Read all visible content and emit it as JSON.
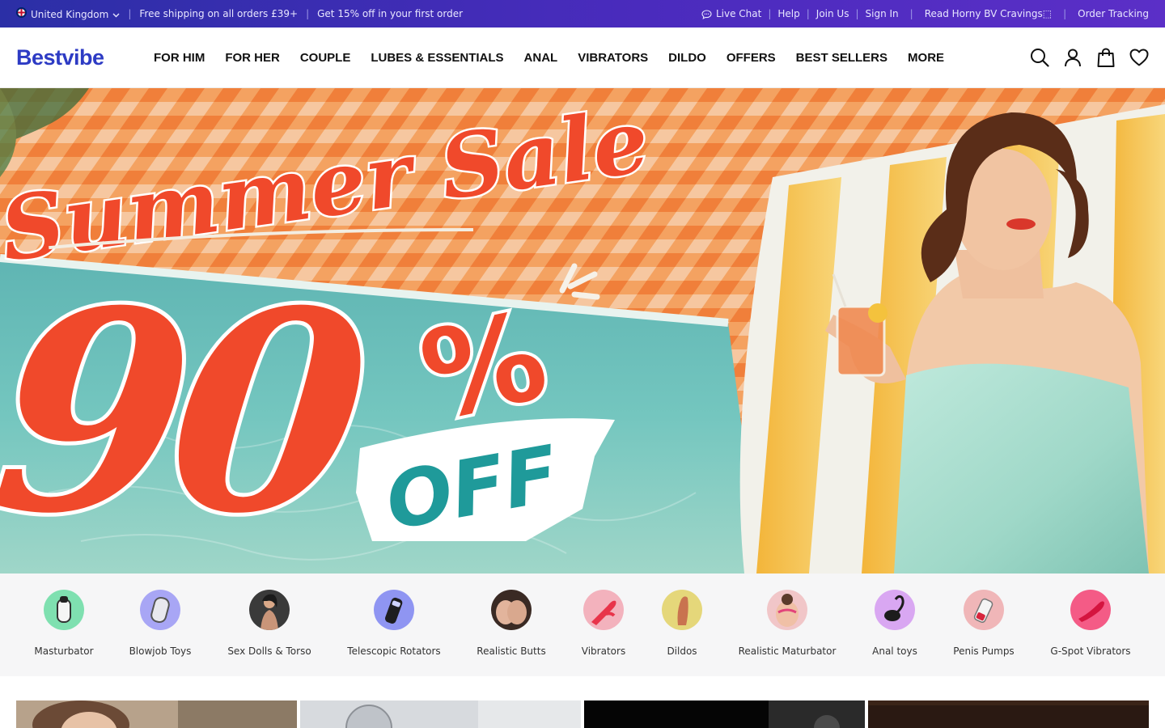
{
  "topbar": {
    "region": "United Kingdom",
    "shipping": "Free shipping on all orders £39+",
    "discount": "Get 15% off in your first order",
    "links": [
      "Live Chat",
      "Help",
      "Join Us",
      "Sign In",
      "Read Horny BV Cravings⬚",
      "Order Tracking"
    ]
  },
  "header": {
    "logo": "Bestvibe",
    "nav": [
      "FOR HIM",
      "FOR HER",
      "COUPLE",
      "LUBES & ESSENTIALS",
      "ANAL",
      "VIBRATORS",
      "DILDO",
      "OFFERS",
      "BEST SELLERS",
      "MORE"
    ],
    "icons": [
      "search-icon",
      "account-icon",
      "bag-icon",
      "heart-icon"
    ]
  },
  "hero": {
    "headline": "Summer Sale",
    "amount": "90",
    "percent": "%",
    "off": "OFF"
  },
  "categories": [
    {
      "label": "Masturbator",
      "color": "#7fe0b0",
      "icon": "masturbator-thumb"
    },
    {
      "label": "Blowjob Toys",
      "color": "#a8a6f5",
      "icon": "blowjob-toy-thumb"
    },
    {
      "label": "Sex Dolls & Torso",
      "color": "#3a3a3a",
      "icon": "doll-thumb"
    },
    {
      "label": "Telescopic Rotators",
      "color": "#8f95f2",
      "icon": "rotator-thumb"
    },
    {
      "label": "Realistic Butts",
      "color": "#d8b7a6",
      "icon": "butt-thumb"
    },
    {
      "label": "Vibrators",
      "color": "#f3b2bd",
      "icon": "vibrator-thumb"
    },
    {
      "label": "Dildos",
      "color": "#e5d77a",
      "icon": "dildo-thumb"
    },
    {
      "label": "Realistic Maturbator",
      "color": "#f1c6c8",
      "icon": "realistic-masturbator-thumb"
    },
    {
      "label": "Anal toys",
      "color": "#d9a7f2",
      "icon": "anal-toy-thumb"
    },
    {
      "label": "Penis Pumps",
      "color": "#f0b6b8",
      "icon": "pump-thumb"
    },
    {
      "label": "G-Spot Vibrators",
      "color": "#f45b86",
      "icon": "gspot-thumb"
    }
  ],
  "colors": {
    "brand": "#2d3bc4",
    "topbar_start": "#2b2fa6",
    "topbar_end": "#5b2fc7",
    "sale_red": "#f0492b",
    "off_teal": "#1f9a9a"
  }
}
